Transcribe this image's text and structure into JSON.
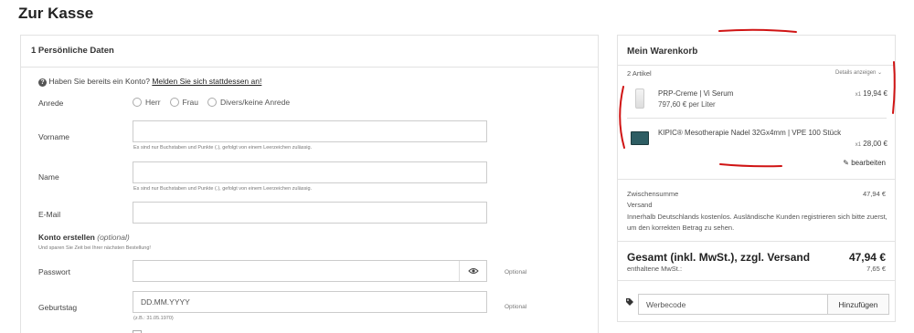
{
  "page": {
    "title": "Zur Kasse"
  },
  "personal": {
    "section_title": "1 Persönliche Daten",
    "login_hint": "Haben Sie bereits ein Konto?",
    "login_link": "Melden Sie sich stattdessen an!",
    "salutation_label": "Anrede",
    "salutation_options": [
      "Herr",
      "Frau",
      "Divers/keine Anrede"
    ],
    "firstname_label": "Vorname",
    "firstname_hint": "Es sind nur Buchstaben und Punkte (.), gefolgt von einem Leerzeichen zulässig.",
    "lastname_label": "Name",
    "lastname_hint": "Es sind nur Buchstaben und Punkte (.), gefolgt von einem Leerzeichen zulässig.",
    "email_label": "E-Mail",
    "account_title": "Konto erstellen",
    "account_optional": "(optional)",
    "account_sub": "Und sparen Sie Zeit bei Ihrer nächsten Bestellung!",
    "password_label": "Passwort",
    "password_optional": "Optional",
    "birthday_label": "Geburtstag",
    "birthday_placeholder": "DD.MM.YYYY",
    "birthday_hint": "(z.B.: 31.05.1970)",
    "birthday_optional": "Optional"
  },
  "cart": {
    "title": "Mein Warenkorb",
    "count": "2 Artikel",
    "details_toggle": "Details anzeigen ⌄",
    "items": [
      {
        "name": "PRP-Creme | Vi Serum",
        "unit_price": "797,60 € per Liter",
        "qty": "x1",
        "price": "19,94 €"
      },
      {
        "name": "KIPIC® Mesotherapie Nadel 32Gx4mm | VPE 100 Stück",
        "qty": "x1",
        "price": "28,00 €"
      }
    ],
    "edit_label": "bearbeiten",
    "subtotal_label": "Zwischensumme",
    "subtotal_value": "47,94 €",
    "shipping_label": "Versand",
    "shipping_note": "Innerhalb Deutschlands kostenlos. Ausländische Kunden registrieren sich bitte zuerst, um den korrekten Betrag zu sehen.",
    "total_label": "Gesamt (inkl. MwSt.), zzgl. Versand",
    "total_value": "47,94 €",
    "vat_label": "enthaltene MwSt.:",
    "vat_value": "7,65 €",
    "coupon_placeholder": "Werbecode",
    "coupon_button": "Hinzufügen"
  },
  "colors": {
    "annotation": "#d01414",
    "border": "#e2e2e2"
  }
}
